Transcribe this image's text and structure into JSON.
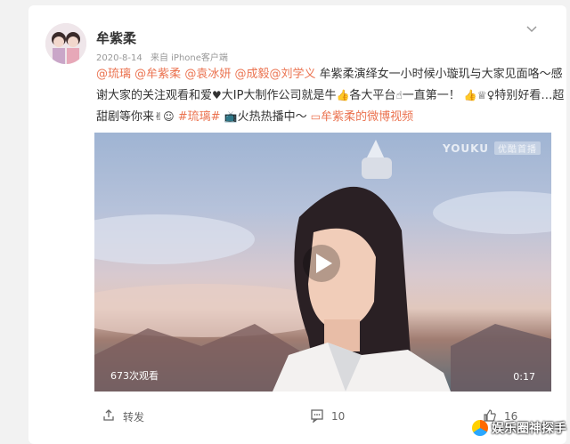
{
  "post": {
    "username": "牟紫柔",
    "date": "2020-8-14",
    "source": "来自 iPhone客户端"
  },
  "content": {
    "mentions": [
      "@琉璃",
      "@牟紫柔",
      "@袁冰妍",
      "@成毅",
      "@刘学义"
    ],
    "text_1": "牟紫柔演绎女一小时候小璇玑与大家见面咯～感谢大家的关注观看和爱",
    "text_2": "大IP大制作公司就是牛",
    "text_3": "各大平台",
    "text_4": "一直第一！",
    "text_5": "特别好看…超甜剧等你来",
    "hashtag": "#琉璃#",
    "text_6": "火热热播中～",
    "video_link": "牟紫柔的微博视频"
  },
  "video": {
    "platform_watermark": "YOUKU",
    "watermark_badge": "优酷首播",
    "view_count": "673次观看",
    "duration": "0:17"
  },
  "actions": {
    "repost_label": "转发",
    "comment_count": "10",
    "like_count": "16"
  },
  "site_watermark": "娱乐圈神探手",
  "icons": [
    "chevron-down-icon",
    "play-icon",
    "share-icon",
    "comment-icon",
    "like-icon",
    "video-link-icon"
  ],
  "colors": {
    "link": "#eb7350",
    "text": "#333333",
    "meta": "#999999"
  }
}
